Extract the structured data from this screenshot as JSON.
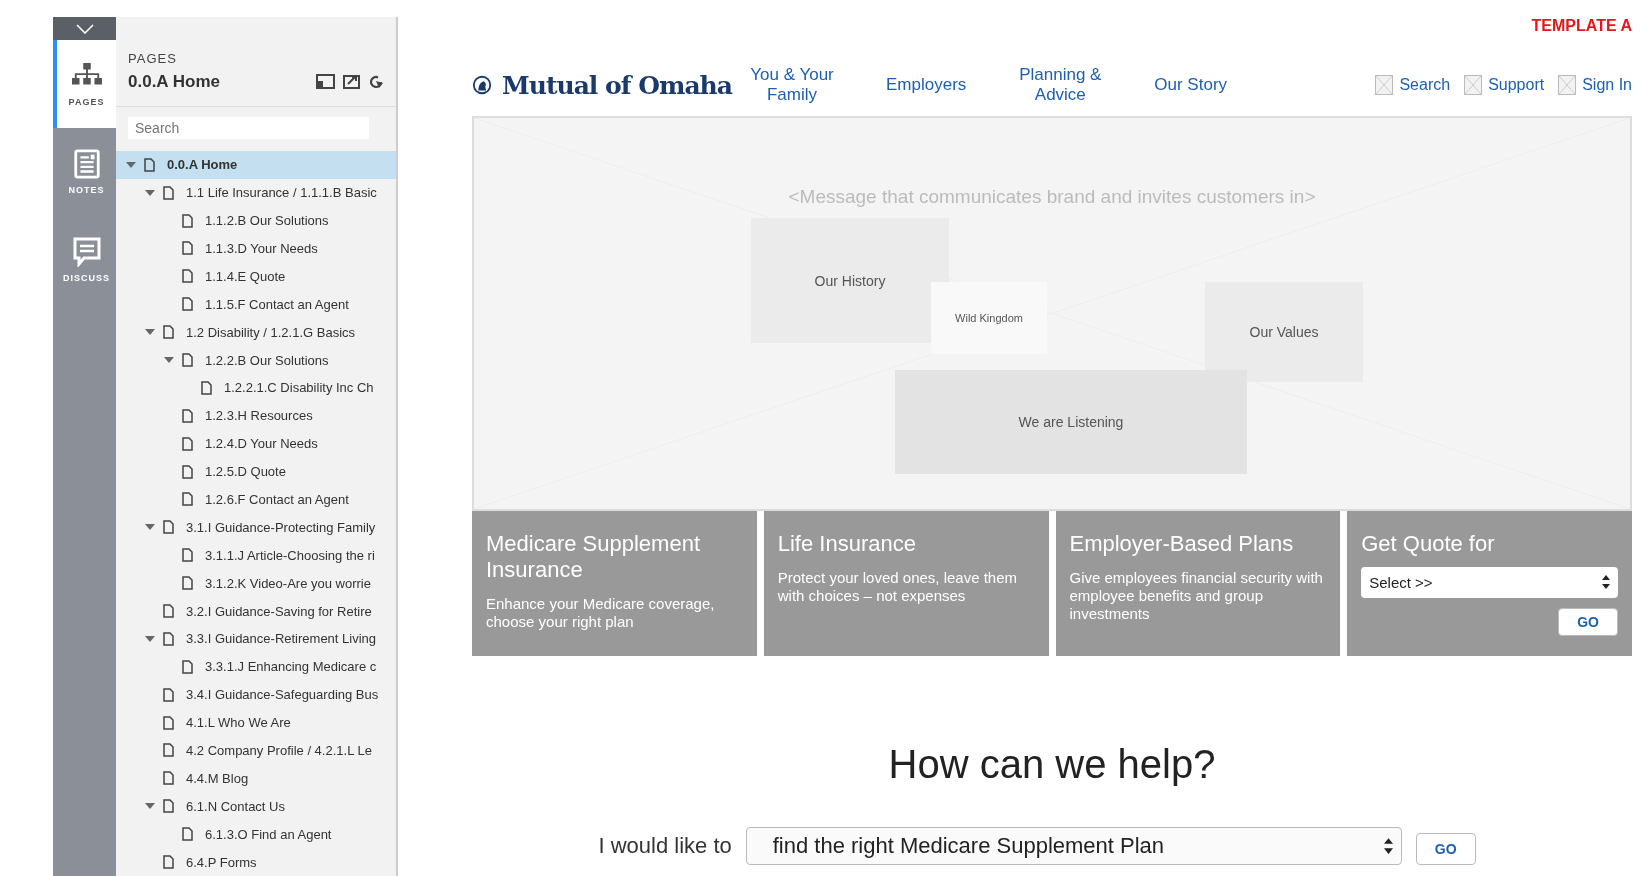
{
  "rail": {
    "tabs": [
      {
        "label": "PAGES",
        "kind": "sitemap",
        "selected": true
      },
      {
        "label": "NOTES",
        "kind": "notes",
        "selected": false
      },
      {
        "label": "DISCUSS",
        "kind": "discuss",
        "selected": false
      }
    ]
  },
  "sidebar": {
    "heading": "PAGES",
    "page_title": "0.0.A Home",
    "search": {
      "placeholder": "Search"
    },
    "tree": [
      {
        "label": "0.0.A Home",
        "selected": true,
        "expanded": true,
        "children": [
          {
            "label": "1.1 Life Insurance / 1.1.1.B Basic",
            "selected": false,
            "expanded": true,
            "children": [
              {
                "label": "1.1.2.B Our Solutions",
                "selected": false
              },
              {
                "label": "1.1.3.D Your Needs",
                "selected": false
              },
              {
                "label": "1.1.4.E Quote",
                "selected": false
              },
              {
                "label": "1.1.5.F Contact an Agent",
                "selected": false
              }
            ]
          },
          {
            "label": "1.2 Disability / 1.2.1.G Basics",
            "selected": false,
            "expanded": true,
            "children": [
              {
                "label": "1.2.2.B Our Solutions",
                "selected": false,
                "expanded": true,
                "children": [
                  {
                    "label": "1.2.2.1.C Disability Inc Ch",
                    "selected": false
                  }
                ]
              },
              {
                "label": "1.2.3.H Resources",
                "selected": false
              },
              {
                "label": "1.2.4.D Your Needs",
                "selected": false
              },
              {
                "label": "1.2.5.D Quote",
                "selected": false
              },
              {
                "label": "1.2.6.F Contact an Agent",
                "selected": false
              }
            ]
          },
          {
            "label": "3.1.I Guidance-Protecting Family",
            "selected": false,
            "expanded": true,
            "children": [
              {
                "label": "3.1.1.J Article-Choosing the ri",
                "selected": false
              },
              {
                "label": "3.1.2.K Video-Are you worrie",
                "selected": false
              }
            ]
          },
          {
            "label": "3.2.I Guidance-Saving for Retire",
            "selected": false
          },
          {
            "label": "3.3.I Guidance-Retirement Living",
            "selected": false,
            "expanded": true,
            "children": [
              {
                "label": "3.3.1.J Enhancing Medicare c",
                "selected": false
              }
            ]
          },
          {
            "label": "3.4.I Guidance-Safeguarding Bus",
            "selected": false
          },
          {
            "label": "4.1.L Who We Are",
            "selected": false
          },
          {
            "label": "4.2 Company Profile / 4.2.1.L Le",
            "selected": false
          },
          {
            "label": "4.4.M Blog",
            "selected": false
          },
          {
            "label": "6.1.N Contact Us",
            "selected": false,
            "expanded": true,
            "children": [
              {
                "label": "6.1.3.O Find an Agent",
                "selected": false
              }
            ]
          },
          {
            "label": "6.4.P Forms",
            "selected": false
          }
        ]
      }
    ]
  },
  "template_label": "TEMPLATE A",
  "header": {
    "logo": "Mutual of Omaha",
    "nav": [
      "You & Your Family",
      "Employers",
      "Planning & Advice",
      "Our Story"
    ],
    "utility_links": [
      "Search",
      "Support",
      "Sign In"
    ]
  },
  "hero": {
    "message": "<Message that communicates brand and invites customers in>",
    "boxes": [
      {
        "label": "Our History",
        "kind": "history"
      },
      {
        "label": "Wild Kingdom",
        "kind": "wild"
      },
      {
        "label": "Our Values",
        "kind": "values"
      },
      {
        "label": "We are Listening",
        "kind": "listening"
      }
    ]
  },
  "cards": [
    {
      "title": "Medicare Supplement Insurance",
      "text": "Enhance your Medicare coverage, choose your right plan"
    },
    {
      "title": "Life Insurance",
      "text": "Protect your loved ones, leave them with choices – not expenses"
    },
    {
      "title": "Employer-Based Plans",
      "text": "Give employees financial security with employee benefits and group investments"
    }
  ],
  "quote": {
    "title": "Get Quote for",
    "select": "Select >>",
    "button": "GO"
  },
  "help": {
    "title": "How can we help?",
    "prompt": "I would like to",
    "select": "find the right Medicare Supplement Plan",
    "button": "GO"
  }
}
